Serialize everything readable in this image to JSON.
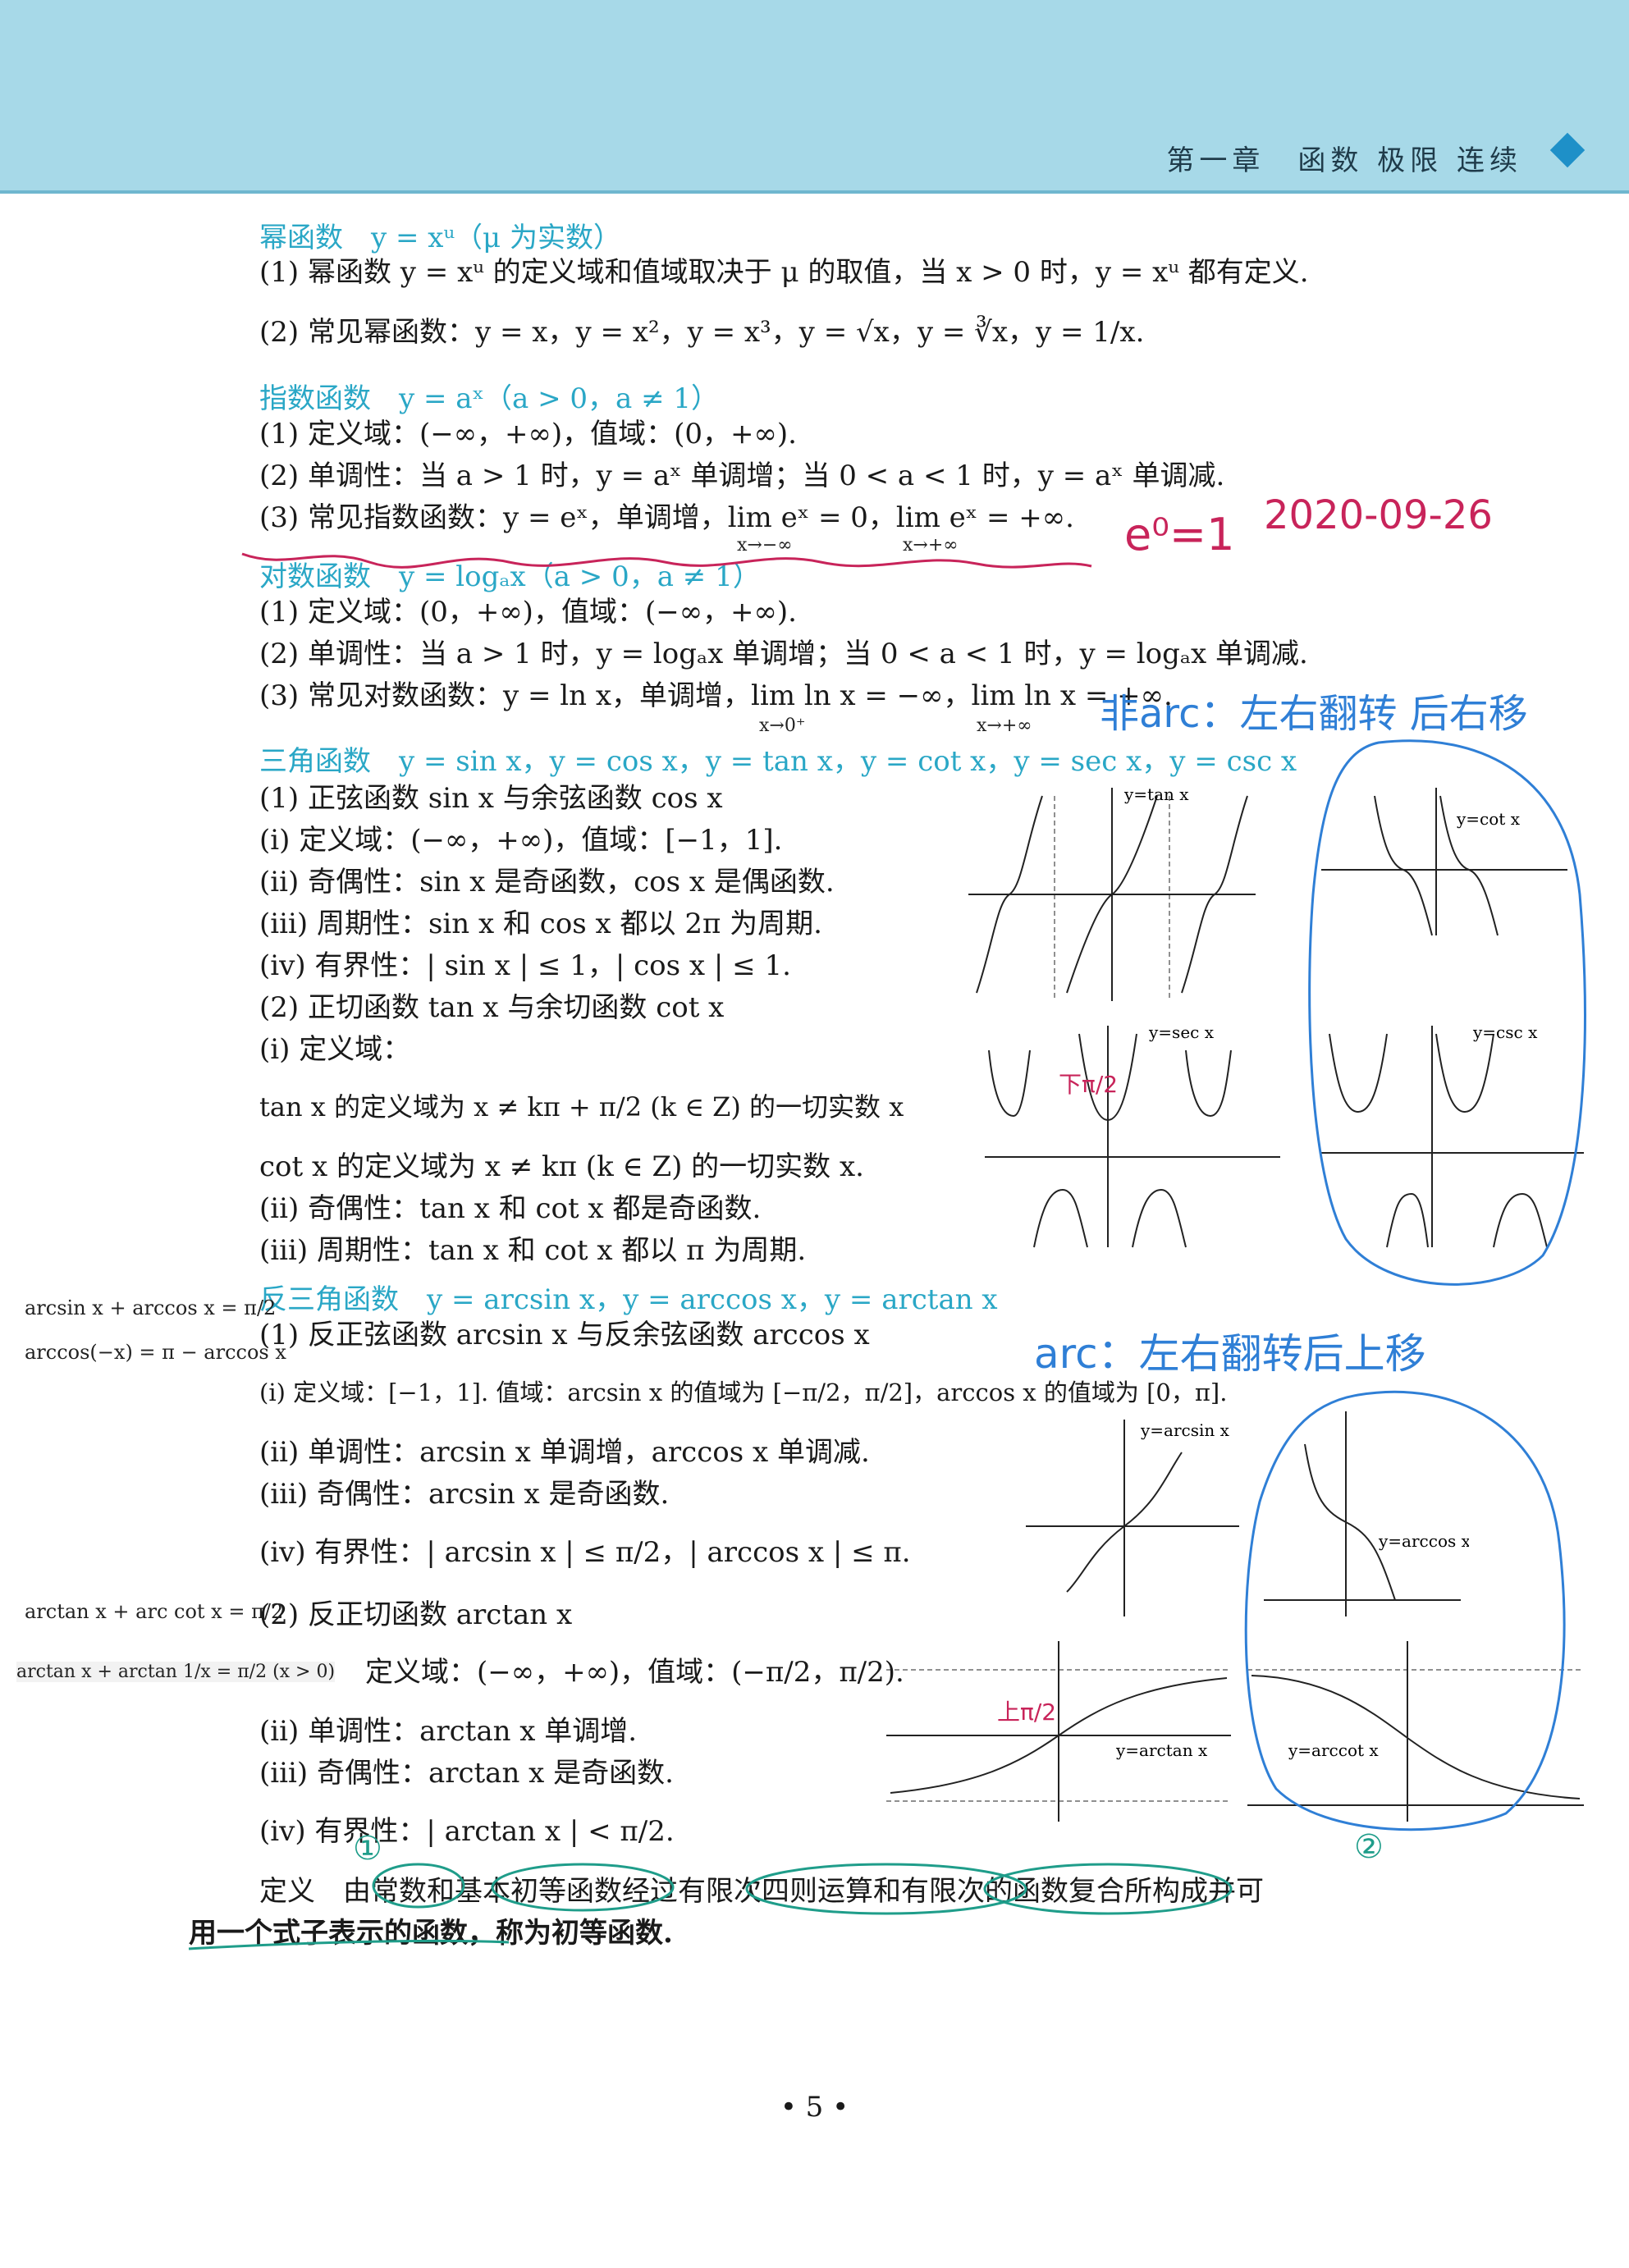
{
  "header": {
    "chapter": "第一章　函数 极限 连续"
  },
  "lines": [
    {
      "id": "power_title",
      "text": "幂函数　y = xᵘ（μ 为实数）"
    },
    {
      "id": "power_1",
      "text": "(1) 幂函数 y = xᵘ 的定义域和值域取决于 μ 的取值，当 x > 0 时，y = xᵘ 都有定义."
    },
    {
      "id": "power_2",
      "text": "(2) 常见幂函数：y = x，y = x²，y = x³，y = √x，y = ∛x，y = 1/x."
    },
    {
      "id": "exp_title",
      "text": "指数函数　y = aˣ（a > 0，a ≠ 1）"
    },
    {
      "id": "exp_1",
      "text": "(1) 定义域：(−∞，+∞)，值域：(0，+∞)."
    },
    {
      "id": "exp_2",
      "text": "(2) 单调性：当 a > 1 时，y = aˣ 单调增；当 0 < a < 1 时，y = aˣ 单调减."
    },
    {
      "id": "exp_3",
      "text": "(3) 常见指数函数：y = eˣ，单调增，lim eˣ = 0，lim eˣ = +∞."
    },
    {
      "id": "log_title",
      "text": "对数函数　y = logₐx（a > 0，a ≠ 1）"
    },
    {
      "id": "log_1",
      "text": "(1) 定义域：(0，+∞)，值域：(−∞，+∞)."
    },
    {
      "id": "log_2",
      "text": "(2) 单调性：当 a > 1 时，y = logₐx 单调增；当 0 < a < 1 时，y = logₐx 单调减."
    },
    {
      "id": "log_3",
      "text": "(3) 常见对数函数：y = ln x，单调增，lim ln x = −∞，lim ln x = +∞."
    },
    {
      "id": "trig_title",
      "text": "三角函数　y = sin x，y = cos x，y = tan x，y = cot x，y = sec x，y = csc x"
    },
    {
      "id": "trig_1",
      "text": "(1) 正弦函数 sin x 与余弦函数 cos x"
    },
    {
      "id": "trig_1i",
      "text": "(ⅰ) 定义域：(−∞，+∞)，值域：[−1，1]."
    },
    {
      "id": "trig_1ii",
      "text": "(ⅱ) 奇偶性：sin x 是奇函数，cos x 是偶函数."
    },
    {
      "id": "trig_1iii",
      "text": "(ⅲ) 周期性：sin x 和 cos x 都以 2π 为周期."
    },
    {
      "id": "trig_1iv",
      "text": "(ⅳ) 有界性：| sin x | ≤ 1，| cos x | ≤ 1."
    },
    {
      "id": "trig_2",
      "text": "(2) 正切函数 tan x 与余切函数 cot x"
    },
    {
      "id": "trig_2i",
      "text": "(ⅰ) 定义域："
    },
    {
      "id": "trig_2i_a",
      "text": "tan x 的定义域为 x ≠ kπ + π/2 (k ∈ Z) 的一切实数 x"
    },
    {
      "id": "trig_2i_b",
      "text": "cot x 的定义域为 x ≠ kπ (k ∈ Z) 的一切实数 x."
    },
    {
      "id": "trig_2ii",
      "text": "(ⅱ) 奇偶性：tan x 和 cot x 都是奇函数."
    },
    {
      "id": "trig_2iii",
      "text": "(ⅲ) 周期性：tan x 和 cot x 都以 π 为周期."
    },
    {
      "id": "inv_title",
      "text": "反三角函数　y = arcsin x，y = arccos x，y = arctan x"
    },
    {
      "id": "inv_1",
      "text": "(1) 反正弦函数 arcsin x 与反余弦函数 arccos x"
    },
    {
      "id": "inv_1i",
      "text": "(ⅰ) 定义域：[−1，1]. 值域：arcsin x 的值域为 [−π/2，π/2]，arccos x 的值域为 [0，π]."
    },
    {
      "id": "inv_1ii",
      "text": "(ⅱ) 单调性：arcsin x 单调增，arccos x 单调减."
    },
    {
      "id": "inv_1iii",
      "text": "(ⅲ) 奇偶性：arcsin x 是奇函数."
    },
    {
      "id": "inv_1iv",
      "text": "(ⅳ) 有界性：| arcsin x | ≤ π/2，| arccos x | ≤ π."
    },
    {
      "id": "inv_2",
      "text": "(2) 反正切函数 arctan x"
    },
    {
      "id": "inv_2i",
      "text": "定义域：(−∞，+∞)，值域：(−π/2，π/2)."
    },
    {
      "id": "inv_2ii",
      "text": "(ⅱ) 单调性：arctan x 单调增."
    },
    {
      "id": "inv_2iii",
      "text": "(ⅲ) 奇偶性：arctan x 是奇函数."
    },
    {
      "id": "inv_2iv",
      "text": "(ⅳ) 有界性：| arctan x | < π/2."
    },
    {
      "id": "def_1",
      "text": "定义　由常数和基本初等函数经过有限次四则运算和有限次的函数复合所构成并可"
    },
    {
      "id": "def_2",
      "text": "用一个式子表示的函数，称为初等函数."
    }
  ],
  "side_notes": {
    "arcsin_arccos": "arcsin x + arccos x = π/2",
    "arccos_neg": "arccos(−x) = π − arccos x",
    "arctan_arccot": "arctan x + arc cot x = π/2",
    "arctan_recip": "arctan x + arctan 1/x = π/2 (x > 0)"
  },
  "handwriting": {
    "e0": "e⁰=1",
    "date": "2020-09-26",
    "non_arc": "非arc：左右翻转 后右移",
    "arc": "arc：左右翻转后上移",
    "lower": "下π/2",
    "up": "上π/2",
    "circle1": "①",
    "circle2": "②"
  },
  "graph_labels": {
    "tan": "y=tan x",
    "cot": "y=cot x",
    "sec": "y=sec x",
    "csc": "y=csc x",
    "arcsin": "y=arcsin x",
    "arccos": "y=arccos x",
    "arctan": "y=arctan x",
    "arccot": "y=arccot x"
  },
  "page_number": "• 5 •",
  "colors": {
    "header_bg": "#a7d9e8",
    "section": "#2aa7c6",
    "pen_blue": "#2f7fd6",
    "pen_red": "#c8245a",
    "pen_green": "#1f9d8a"
  }
}
